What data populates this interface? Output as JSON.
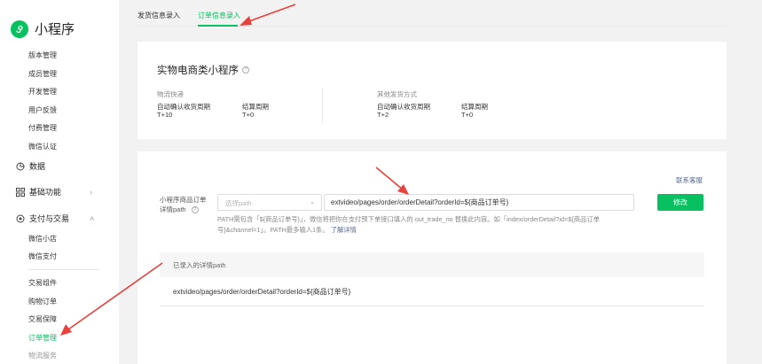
{
  "app": {
    "name": "小程序",
    "logo_icon": "miniprogram-logo-icon"
  },
  "sidebar": {
    "sub_items_top": [
      "版本管理",
      "成员管理",
      "开发管理",
      "用户反馈",
      "付费管理",
      "微信认证"
    ],
    "data_label": "数据",
    "basic_label": "基础功能",
    "pay_label": "支付与交易",
    "pay_items": [
      "微信小店",
      "微信支付"
    ],
    "trade_items": [
      "交易组件",
      "购物订单",
      "交易保障",
      "订单管理",
      "物流服务"
    ]
  },
  "tabs": [
    {
      "label": "发货信息录入"
    },
    {
      "label": "订单信息录入",
      "active": true
    }
  ],
  "summary": {
    "title": "实物电商类小程序",
    "left": {
      "section": "物流快递",
      "confirm_label": "自动确认收货周期",
      "confirm_value": "T+10",
      "settle_label": "结算周期",
      "settle_value": "T+0"
    },
    "right": {
      "section": "其他发货方式",
      "confirm_label": "自动确认收货周期",
      "confirm_value": "T+2",
      "settle_label": "结算周期",
      "settle_value": "T+0"
    }
  },
  "order_path": {
    "contact_link": "联系客服",
    "label_line1": "小程序商品订单",
    "label_line2": "详情path",
    "select_placeholder": "选择path",
    "input_value": "extvideo/pages/order/orderDetail?orderId=${商品订单号}",
    "modify_button": "修改",
    "hint_text": "PATH需包含「${商品订单号}」，微信将把你在支付预下单接口填入的 out_trade_no 替换此内容。如「index/orderDetail?id=${商品订单号}&channel=1」。PATH最多输入1条。",
    "hint_link": "了解详情",
    "recorded_header": "已录入的详情path",
    "recorded_value": "extvideo/pages/order/orderDetail?orderId=${商品订单号}"
  },
  "colors": {
    "accent": "#07c160",
    "link": "#576b95",
    "arrow": "#e8413b"
  }
}
